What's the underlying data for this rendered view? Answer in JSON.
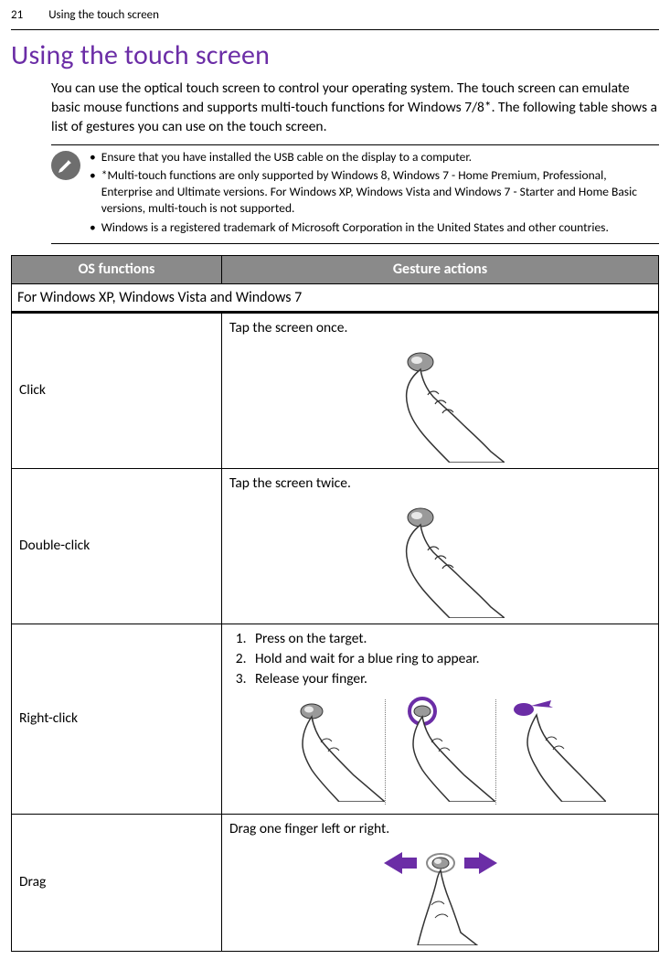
{
  "header": {
    "page_number": "21",
    "running_title": "Using the touch screen"
  },
  "title": "Using the touch screen",
  "intro": "You can use the optical touch screen to control your operating system. The touch screen can emulate basic mouse functions and supports multi-touch functions for Windows 7/8*. The following table shows a list of gestures you can use on the touch screen.",
  "notes": [
    "Ensure that you have installed the USB cable on the display to a computer.",
    "*Multi-touch functions are only supported by Windows 8, Windows 7 - Home Premium, Professional, Enterprise and Ultimate versions. For Windows XP, Windows Vista and Windows 7 - Starter and Home Basic versions, multi-touch is not supported.",
    "Windows is a registered trademark of Microsoft Corporation in the United States and other countries."
  ],
  "table": {
    "headers": {
      "os": "OS functions",
      "gesture": "Gesture actions"
    },
    "section_label": "For Windows XP, Windows Vista and Windows 7",
    "rows": [
      {
        "os": "Click",
        "gesture_text": "Tap the screen once."
      },
      {
        "os": "Double-click",
        "gesture_text": "Tap the screen twice."
      },
      {
        "os": "Right-click",
        "steps": [
          "Press on the target.",
          "Hold and wait for a blue ring to appear.",
          "Release your finger."
        ]
      },
      {
        "os": "Drag",
        "gesture_text": "Drag one finger left or right."
      }
    ]
  },
  "icons": {
    "note": "pencil-icon",
    "arrow_left": "arrow-left-icon",
    "arrow_right": "arrow-right-icon",
    "hand_tap": "hand-tap-icon"
  },
  "colors": {
    "accent": "#6b2da6",
    "header_bg": "#8a8a8a"
  }
}
